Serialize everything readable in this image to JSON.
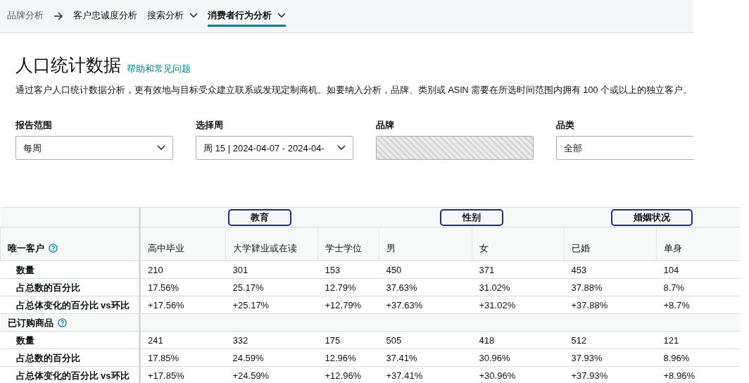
{
  "breadcrumb": [
    {
      "label": "品牌分析",
      "kind": "root"
    },
    {
      "label": "客户忠诚度分析",
      "kind": "link",
      "dropdown": false,
      "selected": false
    },
    {
      "label": "搜索分析",
      "kind": "link",
      "dropdown": true,
      "selected": false
    },
    {
      "label": "消费者行为分析",
      "kind": "link",
      "dropdown": true,
      "selected": true
    }
  ],
  "title": "人口统计数据",
  "help_link": "帮助和常见问题",
  "description": "通过客户人口统计数据分析，更有效地与目标受众建立联系或发现定制商机。如要纳入分析，品牌、类别或 ASIN 需要在所选时间范围内拥有 100 个或以上的独立客户。",
  "filters": [
    {
      "label": "报告范围",
      "value": "每周",
      "kind": "select",
      "chevron": true
    },
    {
      "label": "选择周",
      "value": "周 15 | 2024-04-07 - 2024-04-",
      "kind": "select",
      "chevron": true
    },
    {
      "label": "品牌",
      "kind": "redacted"
    },
    {
      "label": "品类",
      "value": "全部",
      "kind": "select"
    }
  ],
  "table": {
    "groups": [
      {
        "label": "教育",
        "annotated": true,
        "columns": [
          "高中毕业",
          "大学肄业或在读",
          "学士学位"
        ]
      },
      {
        "label": "性别",
        "annotated": true,
        "columns": [
          "男",
          "女"
        ]
      },
      {
        "label": "婚姻状况",
        "annotated": true,
        "columns": [
          "已婚",
          "单身"
        ]
      }
    ],
    "sections": [
      {
        "label": "唯一客户",
        "rows": [
          {
            "label": "数量",
            "cells": [
              "210",
              "301",
              "153",
              "450",
              "371",
              "453",
              "104"
            ]
          },
          {
            "label": "占总数的百分比",
            "cells": [
              "17.56%",
              "25.17%",
              "12.79%",
              "37.63%",
              "31.02%",
              "37.88%",
              "8.7%"
            ]
          },
          {
            "label": "占总体变化的百分比 vs环比",
            "cells": [
              "+17.56%",
              "+25.17%",
              "+12.79%",
              "+37.63%",
              "+31.02%",
              "+37.88%",
              "+8.7%"
            ]
          }
        ]
      },
      {
        "label": "已订购商品",
        "rows": [
          {
            "label": "数量",
            "cells": [
              "241",
              "332",
              "175",
              "505",
              "418",
              "512",
              "121"
            ]
          },
          {
            "label": "占总数的百分比",
            "cells": [
              "17.85%",
              "24.59%",
              "12.96%",
              "37.41%",
              "30.96%",
              "37.93%",
              "8.96%"
            ]
          },
          {
            "label": "占总体变化的百分比 vs环比",
            "cells": [
              "+17.85%",
              "+24.59%",
              "+12.96%",
              "+37.41%",
              "+30.96%",
              "+37.93%",
              "+8.96%"
            ]
          }
        ]
      }
    ]
  }
}
